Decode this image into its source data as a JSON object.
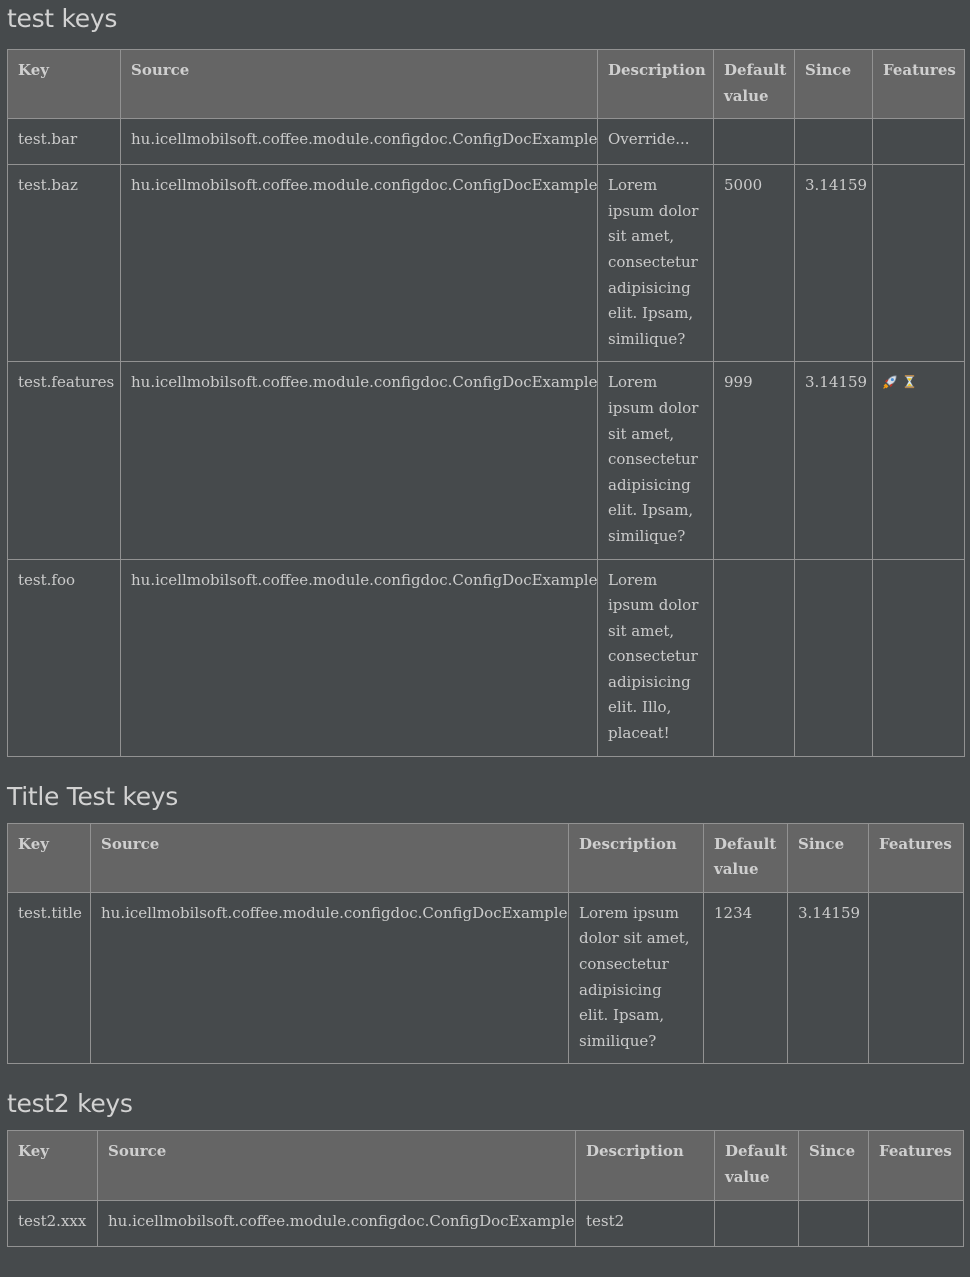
{
  "headers": {
    "key": "Key",
    "source": "Source",
    "description": "Description",
    "default_value": "Default value",
    "since": "Since",
    "features": "Features"
  },
  "sections": [
    {
      "title": "test keys",
      "rows": [
        {
          "key": "test.bar",
          "source": "hu.icellmobilsoft.coffee.module.configdoc.ConfigDocExample",
          "description": "Override...",
          "default_value": "",
          "since": "",
          "features": []
        },
        {
          "key": "test.baz",
          "source": "hu.icellmobilsoft.coffee.module.configdoc.ConfigDocExample",
          "description": "Lorem ipsum dolor sit amet, consectetur adipisicing elit. Ipsam, similique?",
          "default_value": "5000",
          "since": "3.14159",
          "features": []
        },
        {
          "key": "test.features",
          "source": "hu.icellmobilsoft.coffee.module.configdoc.ConfigDocExample",
          "description": "Lorem ipsum dolor sit amet, consectetur adipisicing elit. Ipsam, similique?",
          "default_value": "999",
          "since": "3.14159",
          "features": [
            "rocket-icon",
            "hourglass-icon"
          ]
        },
        {
          "key": "test.foo",
          "source": "hu.icellmobilsoft.coffee.module.configdoc.ConfigDocExample",
          "description": "Lorem ipsum dolor sit amet, consectetur adipisicing elit. Illo, placeat!",
          "default_value": "",
          "since": "",
          "features": []
        }
      ]
    },
    {
      "title": "Title Test keys",
      "rows": [
        {
          "key": "test.title",
          "source": "hu.icellmobilsoft.coffee.module.configdoc.ConfigDocExample",
          "description": "Lorem ipsum dolor sit amet, consectetur adipisicing elit. Ipsam, similique?",
          "default_value": "1234",
          "since": "3.14159",
          "features": []
        }
      ]
    },
    {
      "title": "test2 keys",
      "rows": [
        {
          "key": "test2.xxx",
          "source": "hu.icellmobilsoft.coffee.module.configdoc.ConfigDocExample",
          "description": "test2",
          "default_value": "",
          "since": "",
          "features": []
        }
      ]
    }
  ]
}
